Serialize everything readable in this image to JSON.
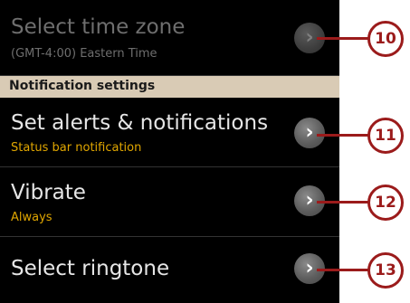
{
  "time_zone": {
    "title": "Select time zone",
    "subtitle": "(GMT-4:00) Eastern Time"
  },
  "notification_section": {
    "header": "Notification settings"
  },
  "alerts": {
    "title": "Set alerts & notifications",
    "subtitle": "Status bar notification"
  },
  "vibrate": {
    "title": "Vibrate",
    "subtitle": "Always"
  },
  "ringtone": {
    "title": "Select ringtone"
  },
  "chevron_glyph": "›",
  "callouts": [
    "10",
    "11",
    "12",
    "13"
  ],
  "colors": {
    "callout": "#9b1b1b",
    "subtitle": "#e0a600",
    "section_header": "#d9cbb5"
  },
  "icons": {
    "row_arrow": "chevron-right-icon"
  }
}
